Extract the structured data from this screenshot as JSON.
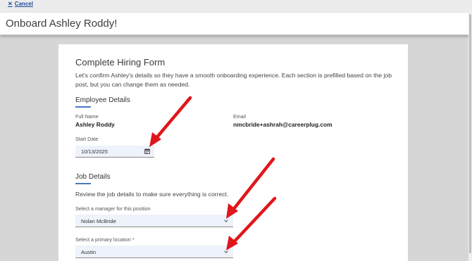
{
  "topbar": {
    "cancel_label": "Cancel"
  },
  "header": {
    "title": "Onboard Ashley Roddy!"
  },
  "form": {
    "title": "Complete Hiring Form",
    "intro": "Let's confirm Ashley's details so they have a smooth onboarding experience. Each section is prefilled based on the job post, but you can change them as needed.",
    "employee": {
      "section_title": "Employee Details",
      "full_name_label": "Full Name",
      "full_name": "Ashley Roddy",
      "email_label": "Email",
      "email": "nmcbride+ashrah@careerplug.com",
      "start_date_label": "Start Date",
      "start_date": "10/13/2025"
    },
    "job": {
      "section_title": "Job Details",
      "review_text": "Review the job details to make sure everything is correct.",
      "manager_label": "Select a manager for this position",
      "manager_value": "Nolan McBride",
      "location_label": "Select a primary location *",
      "location_value": "Austin"
    }
  },
  "colors": {
    "accent": "#4a78c2",
    "arrow": "#e0161b",
    "link": "#1f4e9b"
  },
  "icons": [
    "close-icon",
    "calendar-icon",
    "chevron-down-icon"
  ]
}
